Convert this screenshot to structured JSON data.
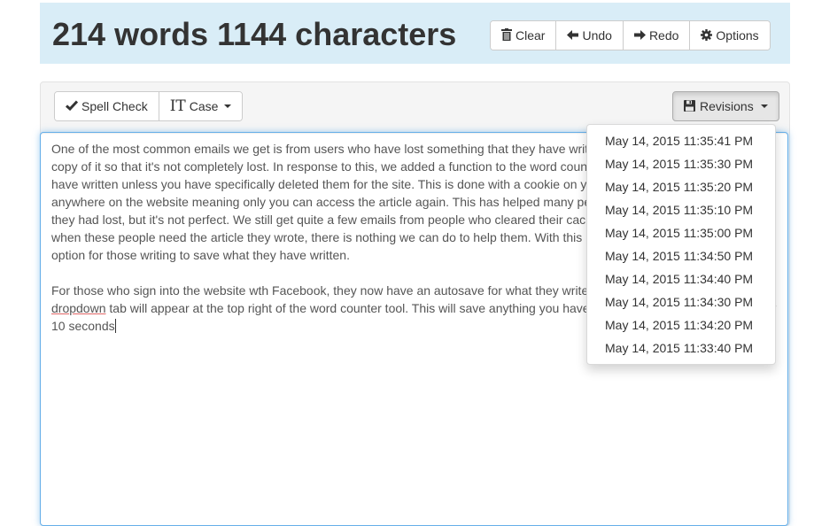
{
  "header": {
    "title": "214 words 1144 characters",
    "buttons": [
      {
        "label": "Clear",
        "icon": "trash-icon"
      },
      {
        "label": "Undo",
        "icon": "arrow-left-icon"
      },
      {
        "label": "Redo",
        "icon": "arrow-right-icon"
      },
      {
        "label": "Options",
        "icon": "gear-icon"
      }
    ]
  },
  "toolbar": {
    "spell_check_label": "Spell Check",
    "case_label": "Case",
    "revisions_label": "Revisions"
  },
  "editor": {
    "paragraph1": "One of the most common emails we get is from users who have lost something that they have written and are hoping that we have a copy of it so that it's not completely lost. In response to this, we added a function to the word counter that saves the last words you have written unless you have specifically deleted them for the site. This is done with a cookie on your computer and it is not saved anywhere on the website meaning only you can access the article again. This has helped many people recover articles they thought they had lost, but it's not perfect. We still get quite a few emails from people who cleared their cache before leaving the website, and when these people need the article they wrote, there is nothing we can do to help them. With this in mind we have created another option for those writing to save what they have written.",
    "paragraph2_before": "For those who sign into the website wth Facebook, they now have an autosave for what they write. Once signed in, a Revisions ",
    "misspelled_word": "dropdown",
    "paragraph2_after": " tab will appear at the top right of the word counter tool. This will save anything you have written on the word counter every 10 seconds"
  },
  "revisions": {
    "items": [
      "May 14, 2015 11:35:41 PM",
      "May 14, 2015 11:35:30 PM",
      "May 14, 2015 11:35:20 PM",
      "May 14, 2015 11:35:10 PM",
      "May 14, 2015 11:35:00 PM",
      "May 14, 2015 11:34:50 PM",
      "May 14, 2015 11:34:40 PM",
      "May 14, 2015 11:34:30 PM",
      "May 14, 2015 11:34:20 PM",
      "May 14, 2015 11:33:40 PM"
    ]
  },
  "colors": {
    "header_bg": "#d9edf7",
    "focus_border": "#66afe9",
    "panel_bg": "#f5f5f5"
  }
}
